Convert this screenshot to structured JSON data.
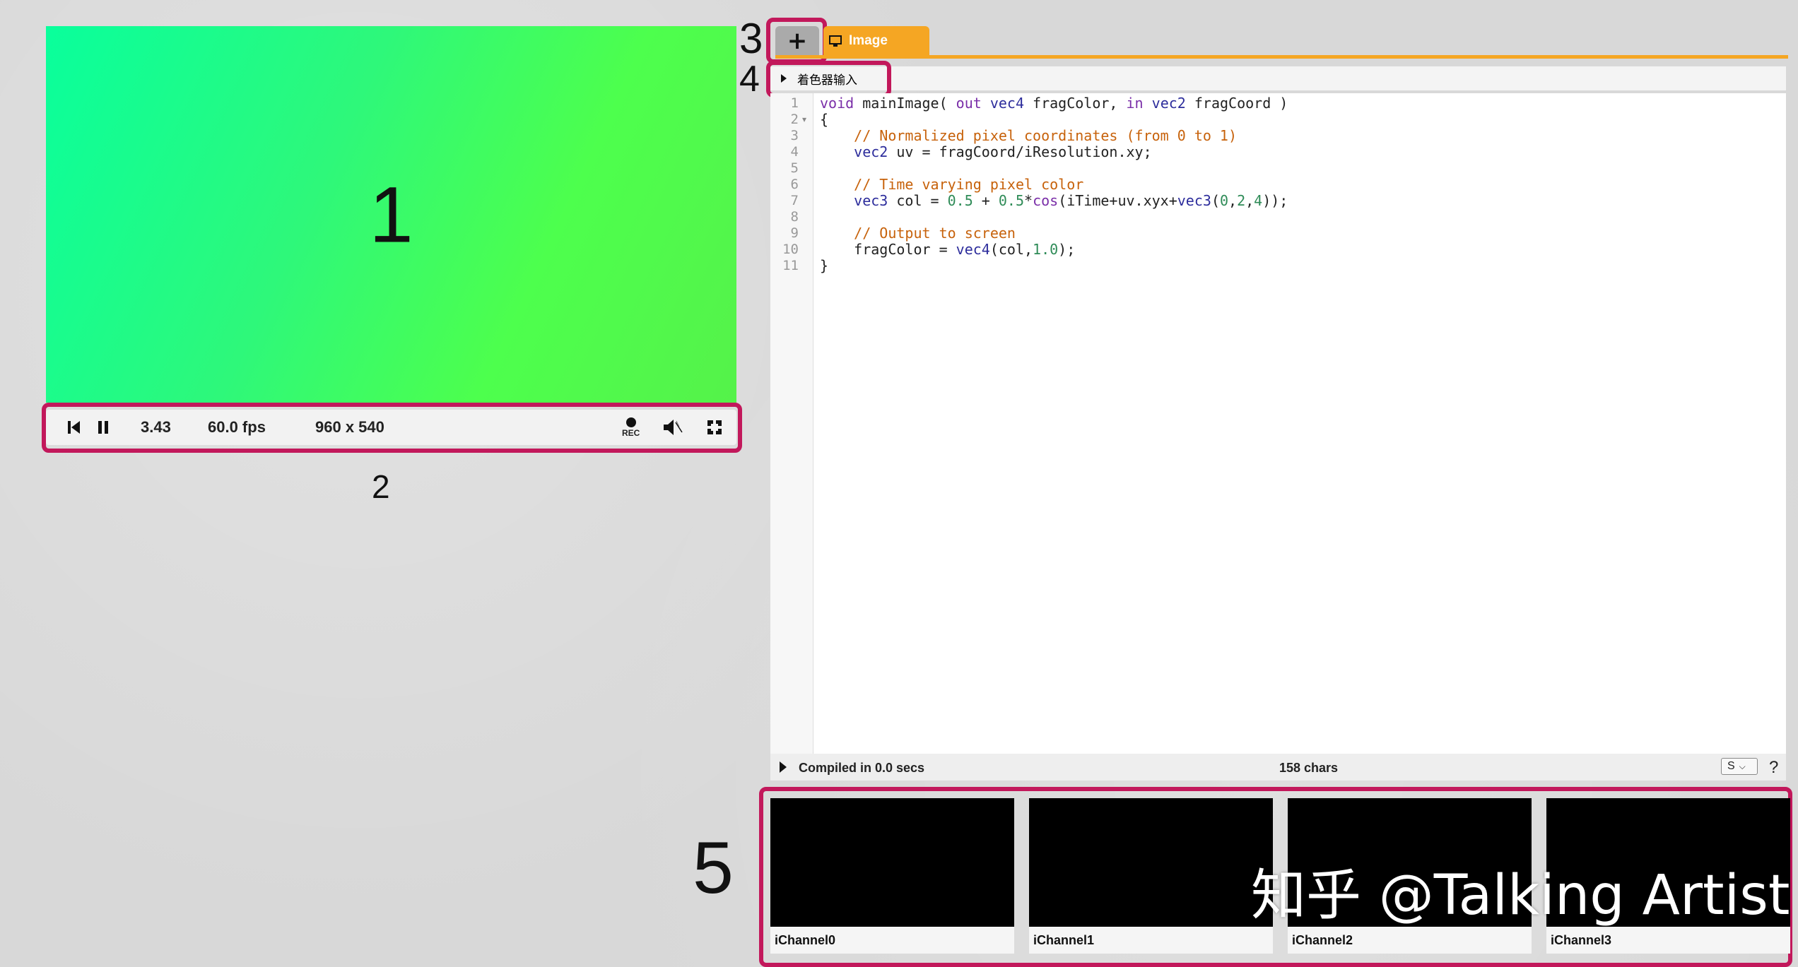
{
  "annotations": {
    "n1": "1",
    "n2": "2",
    "n3": "3",
    "n4": "4",
    "n5": "5"
  },
  "controls": {
    "time": "3.43",
    "fps": "60.0 fps",
    "resolution": "960 x 540",
    "rec_label": "REC"
  },
  "tabs": {
    "add": "+",
    "image": "Image"
  },
  "shader_inputs_label": "着色器输入",
  "code_lines": [
    "void mainImage( out vec4 fragColor, in vec2 fragCoord )",
    "{",
    "    // Normalized pixel coordinates (from 0 to 1)",
    "    vec2 uv = fragCoord/iResolution.xy;",
    "",
    "    // Time varying pixel color",
    "    vec3 col = 0.5 + 0.5*cos(iTime+uv.xyx+vec3(0,2,4));",
    "",
    "    // Output to screen",
    "    fragColor = vec4(col,1.0);",
    "}"
  ],
  "line_numbers": [
    "1",
    "2",
    "3",
    "4",
    "5",
    "6",
    "7",
    "8",
    "9",
    "10",
    "11"
  ],
  "status": {
    "compiled": "Compiled in 0.0 secs",
    "chars": "158 chars",
    "mode": "S",
    "help": "?"
  },
  "channels": [
    "iChannel0",
    "iChannel1",
    "iChannel2",
    "iChannel3"
  ],
  "watermark": "知乎 @Talking Artist",
  "colors": {
    "highlight": "#c2185b",
    "tab_accent": "#f5a623"
  }
}
